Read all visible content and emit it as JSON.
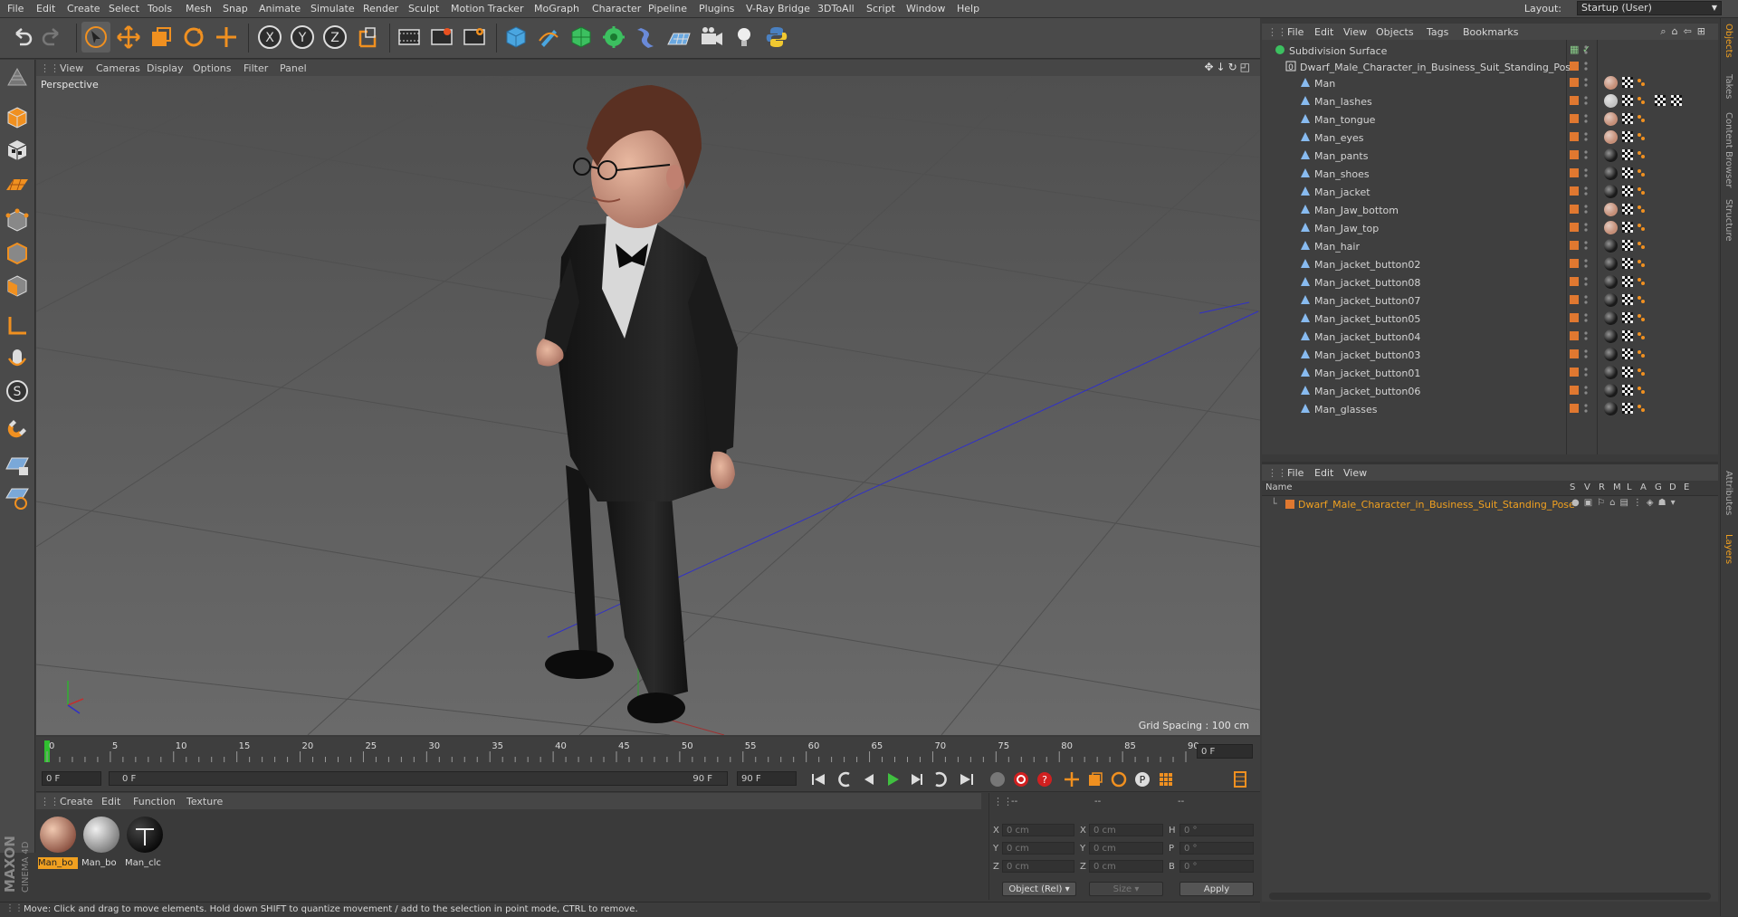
{
  "menubar": {
    "items": [
      "File",
      "Edit",
      "Create",
      "Select",
      "Tools",
      "Mesh",
      "Snap",
      "Animate",
      "Simulate",
      "Render",
      "Sculpt",
      "Motion Tracker",
      "MoGraph",
      "Character",
      "Pipeline",
      "Plugins",
      "V-Ray Bridge",
      "3DToAll",
      "Script",
      "Window",
      "Help"
    ],
    "layout_label": "Layout:",
    "layout_value": "Startup (User)"
  },
  "toolbar": {
    "icons": [
      "undo-icon",
      "redo-icon",
      "select-arrow-icon",
      "move-icon",
      "scale-icon",
      "rotate-icon",
      "add-icon",
      "x-axis-icon",
      "y-axis-icon",
      "z-axis-icon",
      "coordinate-system-icon",
      "render-view-icon",
      "render-picture-viewer-icon",
      "edit-render-settings-icon",
      "cube-icon",
      "pen-icon",
      "subdivision-icon",
      "mograph-cloner-icon",
      "deformer-icon",
      "floor-icon",
      "camera-icon",
      "light-icon",
      "python-icon"
    ],
    "axis_labels": [
      "X",
      "Y",
      "Z"
    ]
  },
  "viewport": {
    "menu": [
      "View",
      "Cameras",
      "Display",
      "Options",
      "Filter",
      "Panel"
    ],
    "title": "Perspective",
    "grid_spacing": "Grid Spacing : 100 cm"
  },
  "timeline": {
    "ticks": [
      "0",
      "5",
      "10",
      "15",
      "20",
      "25",
      "30",
      "35",
      "40",
      "45",
      "50",
      "55",
      "60",
      "65",
      "70",
      "75",
      "80",
      "85",
      "90"
    ],
    "current_frame": "0 F",
    "start_field": "0 F",
    "range_start": "0 F",
    "range_end": "90 F",
    "end_field": "90 F"
  },
  "material_manager": {
    "menu": [
      "Create",
      "Edit",
      "Function",
      "Texture"
    ],
    "materials": [
      {
        "label": "Man_bo",
        "selected": true,
        "color": "#c58f78"
      },
      {
        "label": "Man_bo",
        "selected": false,
        "color": "#c4c4c4"
      },
      {
        "label": "Man_clc",
        "selected": false,
        "color": "#1a1a1a"
      }
    ]
  },
  "coordinates": {
    "header": [
      "--",
      "--",
      "--"
    ],
    "rows": [
      {
        "l1": "X",
        "v1": "0 cm",
        "l2": "X",
        "v2": "0 cm",
        "l3": "H",
        "v3": "0 °"
      },
      {
        "l1": "Y",
        "v1": "0 cm",
        "l2": "Y",
        "v2": "0 cm",
        "l3": "P",
        "v3": "0 °"
      },
      {
        "l1": "Z",
        "v1": "0 cm",
        "l2": "Z",
        "v2": "0 cm",
        "l3": "B",
        "v3": "0 °"
      }
    ],
    "mode": "Object (Rel)",
    "size": "Size",
    "apply": "Apply"
  },
  "status": {
    "text": "Move: Click and drag to move elements. Hold down SHIFT to quantize movement / add to the selection in point mode, CTRL to remove."
  },
  "object_manager": {
    "menu": [
      "File",
      "Edit",
      "View",
      "Objects",
      "Tags",
      "Bookmarks"
    ],
    "root": "Subdivision Surface",
    "group": "Dwarf_Male_Character_in_Business_Suit_Standing_Pose",
    "objects": [
      {
        "name": "Man",
        "mat": "#c58f78"
      },
      {
        "name": "Man_lashes",
        "mat": "#c4c4c4"
      },
      {
        "name": "Man_tongue",
        "mat": "#c58f78"
      },
      {
        "name": "Man_eyes",
        "mat": "#c58f78"
      },
      {
        "name": "Man_pants",
        "mat": "#1a1a1a"
      },
      {
        "name": "Man_shoes",
        "mat": "#1a1a1a"
      },
      {
        "name": "Man_jacket",
        "mat": "#1a1a1a"
      },
      {
        "name": "Man_Jaw_bottom",
        "mat": "#c58f78"
      },
      {
        "name": "Man_Jaw_top",
        "mat": "#c58f78"
      },
      {
        "name": "Man_hair",
        "mat": "#1a1a1a"
      },
      {
        "name": "Man_jacket_button02",
        "mat": "#1a1a1a"
      },
      {
        "name": "Man_jacket_button08",
        "mat": "#1a1a1a"
      },
      {
        "name": "Man_jacket_button07",
        "mat": "#1a1a1a"
      },
      {
        "name": "Man_jacket_button05",
        "mat": "#1a1a1a"
      },
      {
        "name": "Man_jacket_button04",
        "mat": "#1a1a1a"
      },
      {
        "name": "Man_jacket_button03",
        "mat": "#1a1a1a"
      },
      {
        "name": "Man_jacket_button01",
        "mat": "#1a1a1a"
      },
      {
        "name": "Man_jacket_button06",
        "mat": "#1a1a1a"
      },
      {
        "name": "Man_glasses",
        "mat": "#1a1a1a"
      }
    ]
  },
  "layer_manager": {
    "menu": [
      "File",
      "Edit",
      "View"
    ],
    "columns": [
      "Name",
      "S",
      "V",
      "R",
      "M",
      "L",
      "A",
      "G",
      "D",
      "E"
    ],
    "layers": [
      "Dwarf_Male_Character_in_Business_Suit_Standing_Pose"
    ]
  },
  "right_tabs": [
    "Objects",
    "Takes",
    "Content Browser",
    "Structure",
    "Attributes",
    "Layers"
  ],
  "colors": {
    "accent_orange": "#e07830",
    "selection_yellow": "#f0a020",
    "viewport_bg": "#5d5d5d",
    "panel_bg": "#3f3f3f"
  }
}
